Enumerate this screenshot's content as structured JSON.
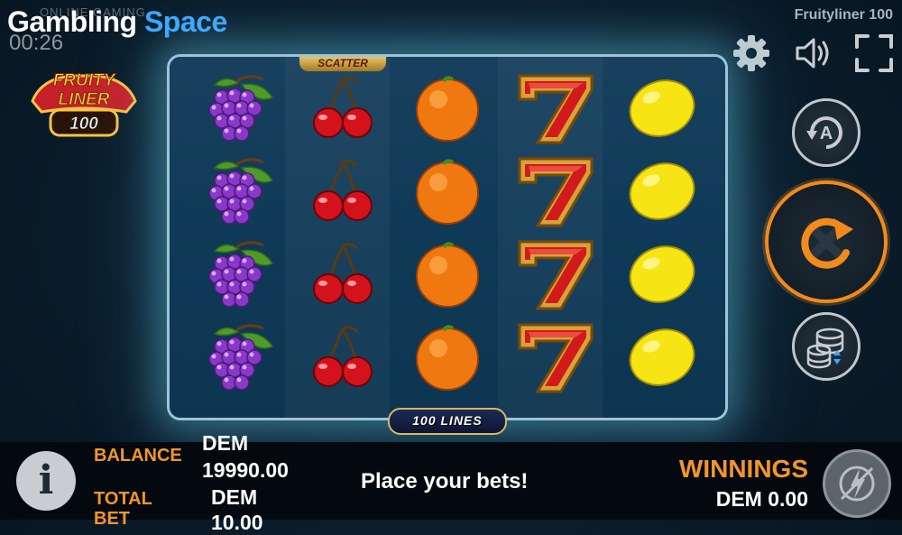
{
  "brand": {
    "word1": "Gambling",
    "word2": "Space",
    "overlay_text": "ONLINE GAMING"
  },
  "timer": "00:26",
  "game_title": "Fruityliner 100",
  "logo": {
    "line1": "FRUITY",
    "line2": "LINER",
    "line3": "100"
  },
  "top_icons": [
    "gear-icon",
    "speaker-icon",
    "fullscreen-icon"
  ],
  "reels": {
    "scatter_label": "SCATTER",
    "columns": [
      [
        "grapes",
        "grapes",
        "grapes",
        "grapes"
      ],
      [
        "cherries",
        "cherries",
        "cherries",
        "cherries"
      ],
      [
        "orange",
        "orange",
        "orange",
        "orange"
      ],
      [
        "seven",
        "seven",
        "seven",
        "seven"
      ],
      [
        "lemon",
        "lemon",
        "lemon",
        "lemon"
      ]
    ]
  },
  "lines_badge": "100 LINES",
  "side_buttons": {
    "autoplay_letter": "A"
  },
  "bottom": {
    "info_label": "i",
    "balance_label": "BALANCE",
    "balance_currency": "DEM",
    "balance_value": "19990.00",
    "total_bet_label_1": "TOTAL",
    "total_bet_label_2": "BET",
    "total_bet_currency": "DEM",
    "total_bet_value": "10.00",
    "status_message": "Place your bets!",
    "winnings_label": "WINNINGS",
    "winnings_value": "DEM 0.00"
  },
  "colors": {
    "accent": "#f3962a",
    "brand_blue": "#3ea7ff",
    "glow": "#6edcff"
  }
}
